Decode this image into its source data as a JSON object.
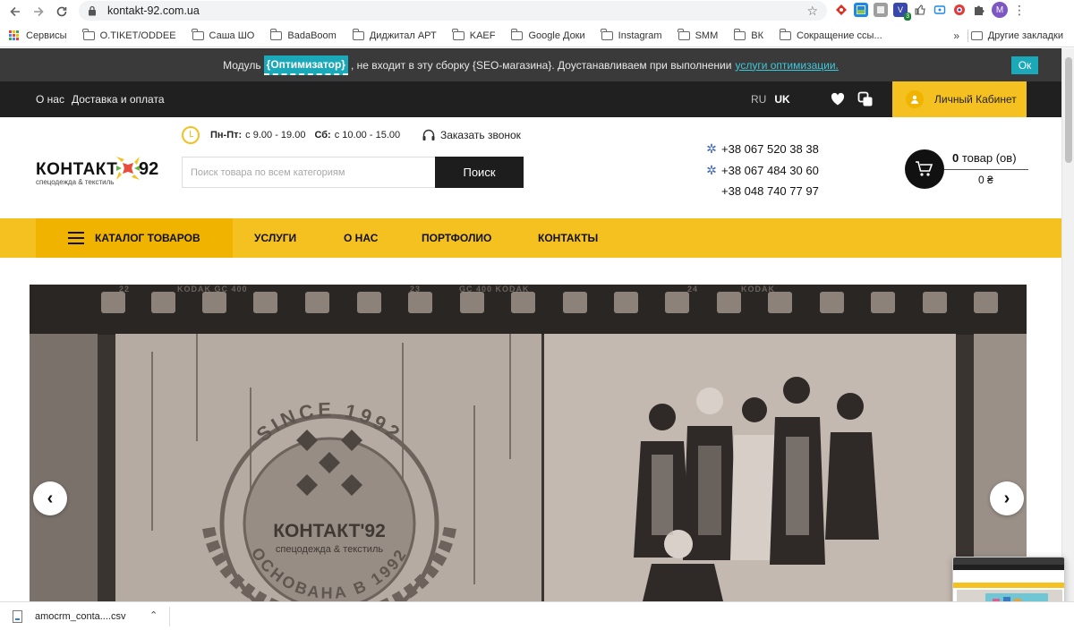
{
  "browser": {
    "url": "kontakt-92.com.ua",
    "extensions_badge": "3",
    "avatar_letter": "M",
    "bookmarks": [
      {
        "label": "Сервисы",
        "type": "apps"
      },
      {
        "label": "O.TIKET/ODDEE",
        "type": "folder"
      },
      {
        "label": "Саша ШО",
        "type": "folder"
      },
      {
        "label": "BadaBoom",
        "type": "folder"
      },
      {
        "label": "Диджитал АРТ",
        "type": "folder"
      },
      {
        "label": "KAEF",
        "type": "folder"
      },
      {
        "label": "Google Доки",
        "type": "folder"
      },
      {
        "label": "Instagram",
        "type": "folder"
      },
      {
        "label": "SMM",
        "type": "folder"
      },
      {
        "label": "ВК",
        "type": "folder"
      },
      {
        "label": "Сокращение ссы...",
        "type": "folder"
      }
    ],
    "bookmarks_more": "»",
    "other_bookmarks": "Другие закладки"
  },
  "notice": {
    "prefix": "Модуль",
    "tag": "{Оптимизатор}",
    "middle": ", не входит в эту сборку {SEO-магазина}. Доустанавливаем при выполнении",
    "link": "услуги оптимизации.",
    "ok_label": "Ок"
  },
  "topbar": {
    "about": "О нас",
    "delivery": "Доставка и оплата",
    "lang_ru": "RU",
    "lang_uk": "UK",
    "cabinet": "Личный Кабинет"
  },
  "header": {
    "logo_word": "КОНТАКТ",
    "logo_num": "92",
    "logo_sub": "спецодежда & текстиль",
    "hours_weekday_label": "Пн-Пт:",
    "hours_weekday": "с 9.00 - 19.00",
    "hours_sat_label": "Сб:",
    "hours_sat": "с 10.00 - 15.00",
    "callback": "Заказать звонок",
    "search_placeholder": "Поиск товара по всем категориям",
    "search_button": "Поиск",
    "phones": [
      "+38 067 520 38 38",
      "+38 067 484 30 60",
      "+38 048 740 77 97"
    ],
    "cart_count_num": "0",
    "cart_count_text": "товар (ов)",
    "cart_price": "0 ₴"
  },
  "nav": {
    "catalog": "КАТАЛОГ ТОВАРОВ",
    "items": [
      "УСЛУГИ",
      "О НАС",
      "ПОРТФОЛИО",
      "КОНТАКТЫ"
    ]
  },
  "banner": {
    "film_labels": [
      "22",
      "KODAK GC 400",
      "23",
      "GC 400 KODAK",
      "24",
      "KODAK"
    ],
    "seal_top": "SINCE 1992",
    "seal_brand": "КОНТАКТ'92",
    "seal_sub": "спецодежда & текстиль",
    "seal_bottom": "ОСНОВАНА В 1992"
  },
  "downloads": {
    "file": "amocrm_conta....csv"
  },
  "colors": {
    "accent_yellow": "#f5c121",
    "accent_teal": "#1ba8b8",
    "dark": "#202020"
  }
}
